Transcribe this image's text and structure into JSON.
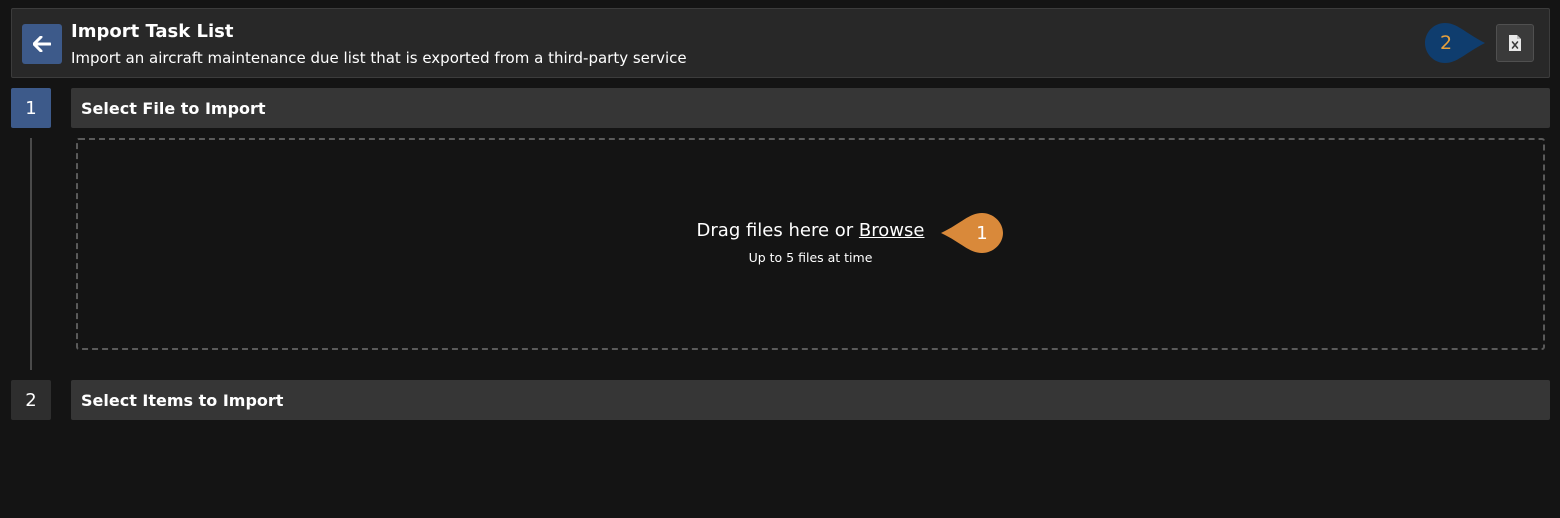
{
  "header": {
    "title": "Import Task List",
    "subtitle": "Import an aircraft maintenance due list that is exported from a third-party service",
    "back_icon": "arrow-left-icon",
    "excel_icon": "file-excel-icon"
  },
  "callouts": [
    {
      "label": "2",
      "color": "#0f3d6e"
    },
    {
      "label": "1",
      "color": "#d9893a"
    }
  ],
  "steps": [
    {
      "number": "1",
      "title": "Select File to Import"
    },
    {
      "number": "2",
      "title": "Select Items to Import"
    }
  ],
  "dropzone": {
    "text": "Drag files here or",
    "link": "Browse",
    "hint": "Up to 5 files at time"
  },
  "colors": {
    "accent": "#3d5a8a",
    "background": "#141414",
    "panel": "#282828",
    "section": "#363636"
  }
}
